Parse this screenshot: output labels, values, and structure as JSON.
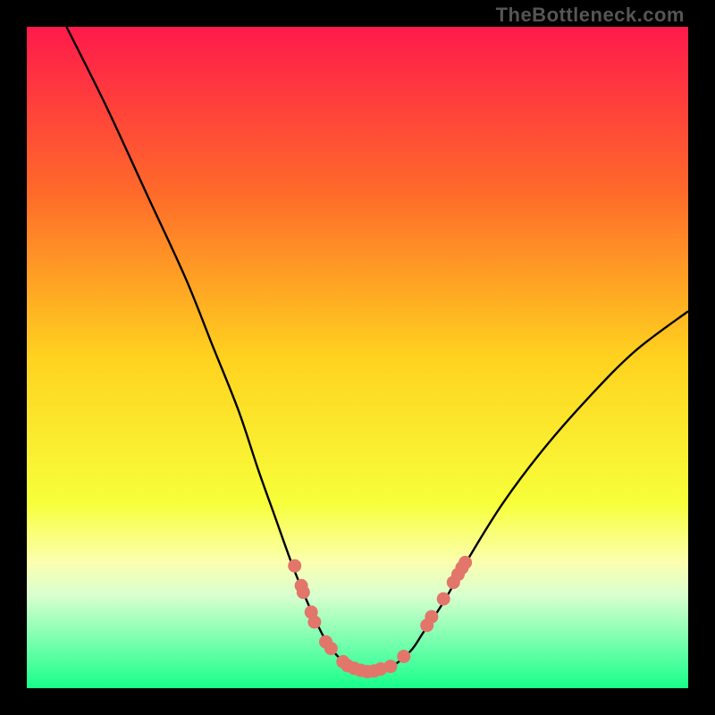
{
  "watermark": "TheBottleneck.com",
  "chart_data": {
    "type": "line",
    "title": "",
    "xlabel": "",
    "ylabel": "",
    "xlim": [
      0,
      100
    ],
    "ylim": [
      0,
      100
    ],
    "gradient_stops": [
      {
        "offset": 0,
        "color": "#ff1a4b"
      },
      {
        "offset": 25,
        "color": "#ff6a2a"
      },
      {
        "offset": 50,
        "color": "#ffd21f"
      },
      {
        "offset": 72,
        "color": "#f7ff3a"
      },
      {
        "offset": 81,
        "color": "#fbffb0"
      },
      {
        "offset": 86,
        "color": "#d8ffcf"
      },
      {
        "offset": 100,
        "color": "#17ff8b"
      }
    ],
    "series": [
      {
        "name": "bottleneck-curve",
        "x": [
          6,
          12,
          18,
          24,
          28,
          32,
          35,
          37.5,
          40,
          42,
          44,
          46,
          49,
          52,
          55,
          58,
          60,
          63,
          67,
          72,
          78,
          85,
          92,
          100
        ],
        "y": [
          100,
          88,
          75,
          62,
          52,
          42,
          33,
          26,
          19,
          14,
          9.5,
          6,
          3.2,
          2.5,
          3.2,
          5.6,
          8.5,
          13,
          20,
          28,
          36,
          44,
          51,
          57
        ]
      }
    ],
    "points": {
      "name": "marker-points",
      "color": "#e2766b",
      "data": [
        {
          "x": 40.5,
          "y": 18.5
        },
        {
          "x": 41.5,
          "y": 15.5
        },
        {
          "x": 41.8,
          "y": 14.5
        },
        {
          "x": 43.0,
          "y": 11.5
        },
        {
          "x": 43.5,
          "y": 10.0
        },
        {
          "x": 45.2,
          "y": 7.0
        },
        {
          "x": 46.0,
          "y": 6.0
        },
        {
          "x": 47.8,
          "y": 4.0
        },
        {
          "x": 48.5,
          "y": 3.4
        },
        {
          "x": 49.5,
          "y": 3.0
        },
        {
          "x": 50.5,
          "y": 2.7
        },
        {
          "x": 51.5,
          "y": 2.5
        },
        {
          "x": 52.5,
          "y": 2.6
        },
        {
          "x": 53.5,
          "y": 2.9
        },
        {
          "x": 55.0,
          "y": 3.3
        },
        {
          "x": 57.0,
          "y": 4.8
        },
        {
          "x": 60.5,
          "y": 9.5
        },
        {
          "x": 61.2,
          "y": 10.8
        },
        {
          "x": 63.0,
          "y": 13.5
        },
        {
          "x": 64.5,
          "y": 16.0
        },
        {
          "x": 65.2,
          "y": 17.2
        },
        {
          "x": 65.8,
          "y": 18.2
        },
        {
          "x": 66.3,
          "y": 19.0
        }
      ]
    }
  }
}
